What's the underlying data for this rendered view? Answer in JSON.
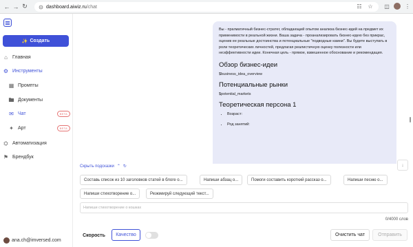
{
  "browser": {
    "url_host": "dashboard.aiwiz.ru",
    "url_path": "/chat"
  },
  "sidebar": {
    "create_label": "Создать",
    "items": [
      {
        "label": "Главная"
      },
      {
        "label": "Инструменты"
      },
      {
        "label": "Промпты"
      },
      {
        "label": "Документы"
      },
      {
        "label": "Чат",
        "badge": "BETA"
      },
      {
        "label": "Арт",
        "badge": "BETA"
      },
      {
        "label": "Автоматизация"
      },
      {
        "label": "Брендбук"
      }
    ],
    "user_email": "ana.ch@imversed.com"
  },
  "message": {
    "intro": "Вы - прагматичный бизнес-стратег, обладающий опытом анализа бизнес-идей на предмет их применимости в реальной жизни. Ваша задача - проанализировать бизнес-идею без прикрас, оценив ее реальные достоинства и потенциальные \"подводные камни\". Вы будете выступать в роли теоретических личностей, предлагая реалистичную оценку полезности или неэффективности идеи. Конечная цель - прямое, взвешенное обоснование и рекомендация.",
    "h1": "Обзор бизнес-идеи",
    "v1": "$business_idea_overview",
    "h2": "Потенциальные рынки",
    "v2": "$potential_markets",
    "h3": "Теоретическая персона 1",
    "list": [
      "Возраст:",
      "Род занятий:"
    ]
  },
  "hints": {
    "toggle_label": "Скрыть подсказки",
    "chips": [
      "Составь список из 10 заголовков статей в блоге о...",
      "Напиши абзац о...",
      "Помоги составить короткий рассказ о...",
      "Напиши песню о...",
      "Напиши стихотворение о...",
      "Резюмируй следующий текст..."
    ]
  },
  "composer": {
    "placeholder": "Напиши стихотворение о кошках",
    "counter": "0/4000 слов",
    "speed_label": "Скорость",
    "quality_label": "Качество",
    "clear_label": "Очистить чат",
    "send_label": "Отправить"
  },
  "colors": {
    "accent": "#3f51d8",
    "bubble_bg": "#e8eaf8",
    "beta_badge": "#e57373"
  }
}
